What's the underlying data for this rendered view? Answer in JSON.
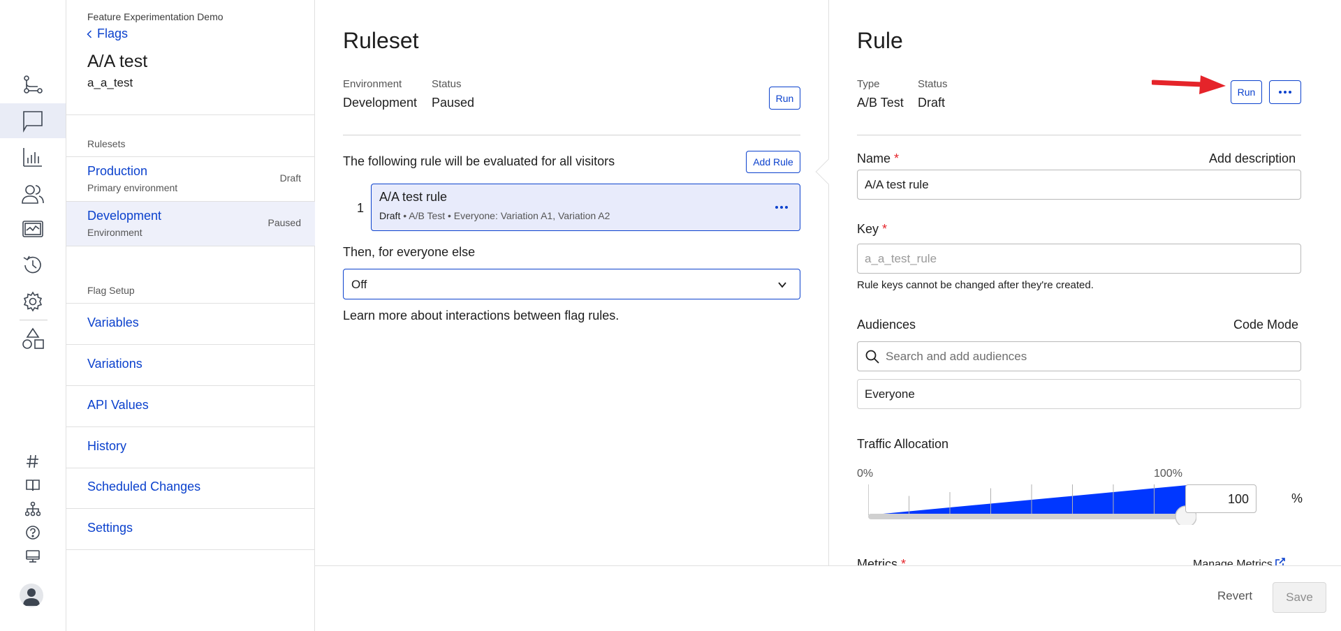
{
  "rail": {
    "icons": [
      "flags-nodes-icon",
      "flag-icon",
      "bar-chart-icon",
      "audiences-icon",
      "monitor-chart-icon",
      "history-icon",
      "gear-icon",
      "shapes-icon"
    ],
    "bottom_icons": [
      "hashtag-icon",
      "book-icon",
      "sitemap-icon",
      "help-icon",
      "desktop-icon",
      "user-avatar-icon"
    ]
  },
  "flagnav": {
    "project": "Feature Experimentation Demo",
    "back_label": "Flags",
    "flag_title": "A/A test",
    "flag_key": "a_a_test",
    "rulesets_heading": "Rulesets",
    "rulesets": [
      {
        "name": "Production",
        "sub": "Primary environment",
        "status": "Draft"
      },
      {
        "name": "Development",
        "sub": "Environment",
        "status": "Paused"
      }
    ],
    "setup_heading": "Flag Setup",
    "setup_items": [
      "Variables",
      "Variations",
      "API Values",
      "History",
      "Scheduled Changes",
      "Settings"
    ]
  },
  "ruleset": {
    "title": "Ruleset",
    "env_label": "Environment",
    "env_value": "Development",
    "status_label": "Status",
    "status_value": "Paused",
    "run_label": "Run",
    "evaluated_text": "The following rule will be evaluated for all visitors",
    "add_rule_label": "Add Rule",
    "rule_index": "1",
    "rule_title": "A/A test rule",
    "rule_status": "Draft",
    "rule_meta": " • A/B Test • Everyone: Variation A1, Variation A2",
    "everyone_else": "Then, for everyone else",
    "fallback_value": "Off",
    "learn_more": "Learn more about interactions between flag rules."
  },
  "rule": {
    "title": "Rule",
    "type_label": "Type",
    "type_value": "A/B Test",
    "status_label": "Status",
    "status_value": "Draft",
    "run_label": "Run",
    "name_label": "Name",
    "required_mark": "*",
    "add_description": "Add description",
    "name_value": "A/A test rule",
    "key_label": "Key",
    "key_placeholder": "a_a_test_rule",
    "key_hint": "Rule keys cannot be changed after they're created.",
    "audiences_label": "Audiences",
    "code_mode": "Code Mode",
    "audience_search_placeholder": "Search and add audiences",
    "audience_selected": "Everyone",
    "traffic_label": "Traffic Allocation",
    "traffic_min": "0%",
    "traffic_max": "100%",
    "traffic_value": "100",
    "traffic_fraction": 1.0,
    "percent_sign": "%",
    "metrics_label": "Metrics",
    "manage_metrics": "Manage Metrics"
  },
  "footer": {
    "revert_label": "Revert",
    "save_label": "Save"
  },
  "colors": {
    "accent": "#0b41cd",
    "slider_fill": "#0037ff",
    "annotation_arrow": "#e5242a"
  }
}
